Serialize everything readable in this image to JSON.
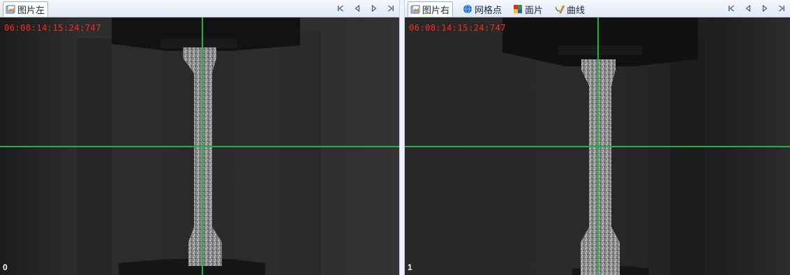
{
  "left_panel": {
    "tab_label": "图片左",
    "tab_icon": "image-icon",
    "timestamp": "06:08:14:15:24:747",
    "frame_index": "0",
    "nav_buttons": [
      "first-frame-icon",
      "prev-frame-icon",
      "next-frame-icon",
      "last-frame-icon"
    ]
  },
  "right_panel": {
    "tabs": [
      {
        "label": "图片右",
        "icon": "image-icon",
        "active": true
      },
      {
        "label": "网格点",
        "icon": "globe-icon",
        "active": false
      },
      {
        "label": "面片",
        "icon": "color-grid-icon",
        "active": false
      },
      {
        "label": "曲线",
        "icon": "pencil-curve-icon",
        "active": false
      }
    ],
    "timestamp": "06:08:14:15:24:747",
    "frame_index": "1",
    "nav_buttons": [
      "first-frame-icon",
      "prev-frame-icon",
      "next-frame-icon",
      "last-frame-icon"
    ]
  },
  "colors": {
    "crosshair": "#1fb34a",
    "timestamp": "#ff2a1a",
    "viewport_bg": "#242424"
  }
}
